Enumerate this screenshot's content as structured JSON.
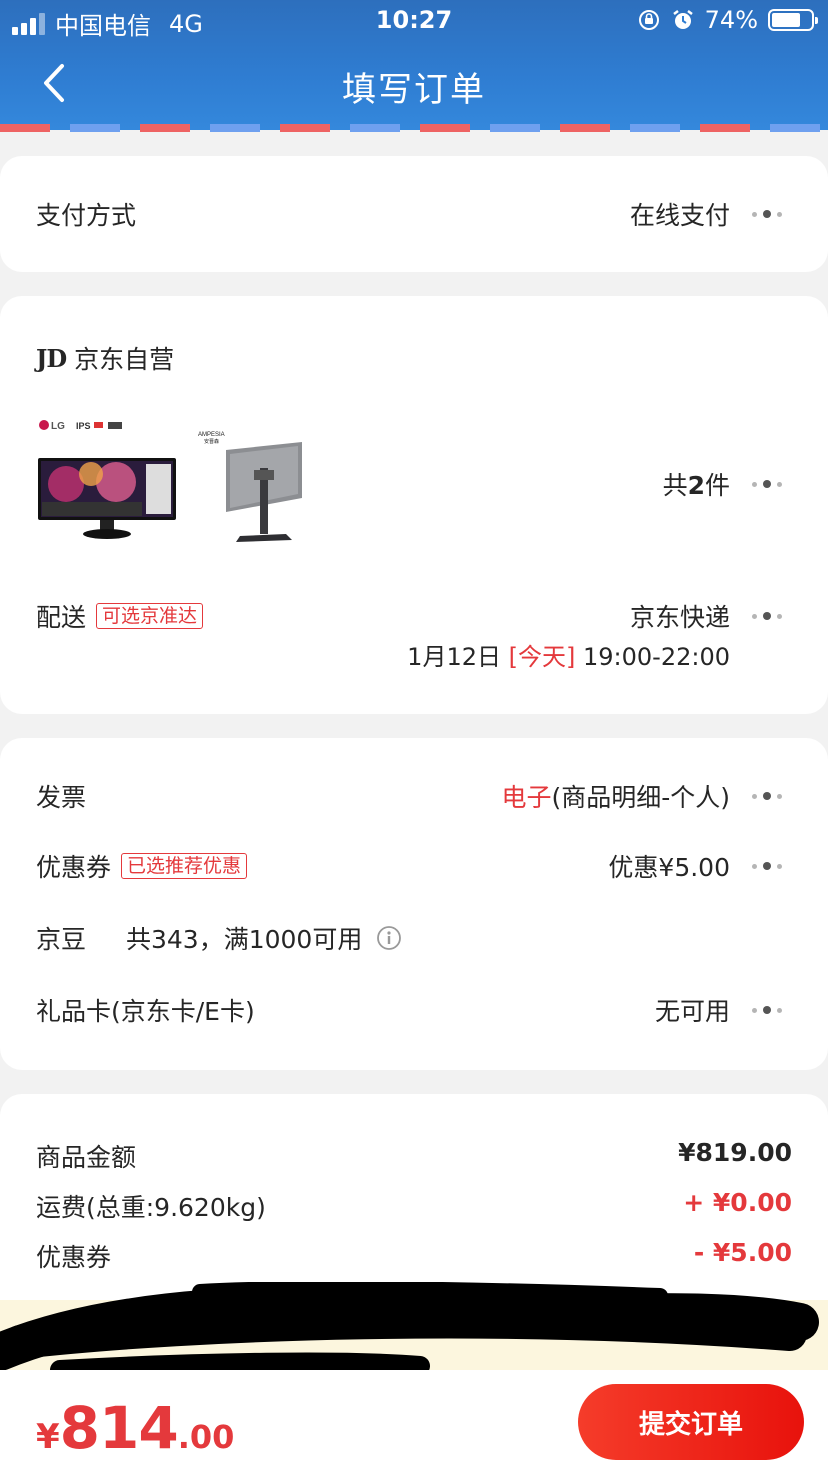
{
  "status_bar": {
    "carrier": "中国电信",
    "network": "4G",
    "time": "10:27",
    "battery": "74%",
    "battery_level": 0.74
  },
  "header": {
    "title": "填写订单"
  },
  "payment": {
    "label": "支付方式",
    "value": "在线支付"
  },
  "shop": {
    "logo": "JD",
    "name": "京东自营",
    "products": [
      {
        "brand_badges": "LG  IPS",
        "desc": "LG ultrawide monitor"
      },
      {
        "brand_badges": "AMPESIA",
        "desc": "monitor on stand"
      }
    ],
    "count_prefix": "共",
    "count": "2",
    "count_suffix": "件",
    "delivery_label": "配送",
    "delivery_tag": "可选京准达",
    "delivery_method": "京东快递",
    "delivery_date": "1月12日",
    "delivery_today": "[今天]",
    "delivery_time": "19:00-22:00"
  },
  "options": {
    "invoice_label": "发票",
    "invoice_type": "电子",
    "invoice_detail": "(商品明细-个人)",
    "coupon_label": "优惠券",
    "coupon_tag": "已选推荐优惠",
    "coupon_value": "优惠¥5.00",
    "beans_label": "京豆",
    "beans_value": "共343，满1000可用",
    "giftcard_label": "礼品卡(京东卡/E卡)",
    "giftcard_value": "无可用"
  },
  "summary": {
    "goods_label": "商品金额",
    "goods_amount": "¥819.00",
    "freight_label": "运费(总重:9.620kg)",
    "freight_amount": "+ ¥0.00",
    "coupon_label": "优惠券",
    "coupon_amount": "- ¥5.00"
  },
  "bottom": {
    "currency": "¥",
    "total_int": "814",
    "total_dec": ".00",
    "submit_label": "提交订单"
  },
  "colors": {
    "header_blue": "#2f7dd2",
    "accent_red": "#e4393c",
    "submit_red": "#f02a1a"
  }
}
